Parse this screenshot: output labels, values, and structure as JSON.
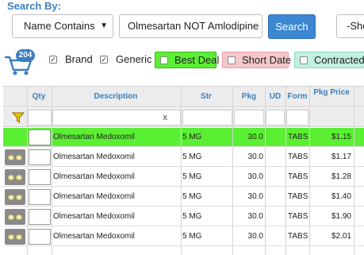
{
  "search": {
    "label": "Search By:",
    "mode": "Name Contains",
    "query": "Olmesartan NOT Amlodipine",
    "button": "Search",
    "second_select": "-Sho"
  },
  "cart": {
    "count": "204"
  },
  "filters": {
    "brand": "Brand",
    "generic": "Generic",
    "best_deal": "Best Deal",
    "short_date": "Short Date",
    "contracted": "Contracted"
  },
  "columns": {
    "qty": "Qty",
    "description": "Description",
    "str": "Str",
    "pkg": "Pkg",
    "ud": "UD",
    "form": "Form",
    "pkg_price": "Pkg Price"
  },
  "filter_row": {
    "clear": "x"
  },
  "rows": [
    {
      "description": "Olmesartan Medoxomil",
      "str": "5 MG",
      "pkg": "30.0",
      "form": "TABS",
      "price": "$1.15"
    },
    {
      "description": "Olmesartan Medoxomil",
      "str": "5 MG",
      "pkg": "30.0",
      "form": "TABS",
      "price": "$1.17"
    },
    {
      "description": "Olmesartan Medoxomil",
      "str": "5 MG",
      "pkg": "30.0",
      "form": "TABS",
      "price": "$1.28"
    },
    {
      "description": "Olmesartan Medoxomil",
      "str": "5 MG",
      "pkg": "30.0",
      "form": "TABS",
      "price": "$1.40"
    },
    {
      "description": "Olmesartan Medoxomil",
      "str": "5 MG",
      "pkg": "30.0",
      "form": "TABS",
      "price": "$1.90"
    },
    {
      "description": "Olmesartan Medoxomil",
      "str": "5 MG",
      "pkg": "30.0",
      "form": "TABS",
      "price": "$2.01"
    }
  ],
  "colors": {
    "accent": "#3a7fc1",
    "best_deal": "#5bef33",
    "short_date": "#f5c6cb",
    "contracted": "#c2f0e0"
  },
  "icons": {
    "cart": "shopping-cart-icon",
    "filter": "filter-funnel-icon",
    "chevron": "chevron-down-icon"
  }
}
